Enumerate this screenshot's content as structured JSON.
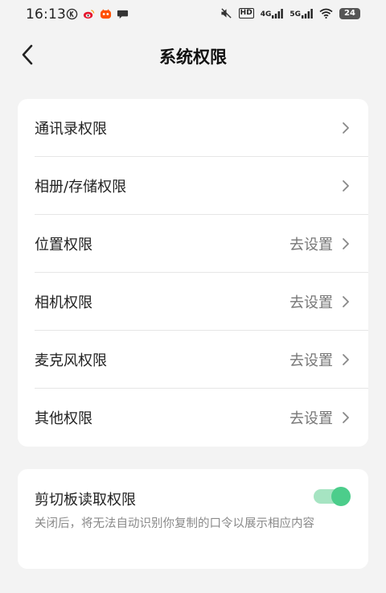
{
  "status_bar": {
    "time": "16:13",
    "hd_label": "HD",
    "net_4g": "4G",
    "net_5g": "5G",
    "battery": "24"
  },
  "header": {
    "title": "系统权限"
  },
  "permissions": [
    {
      "label": "通讯录权限",
      "value": ""
    },
    {
      "label": "相册/存储权限",
      "value": ""
    },
    {
      "label": "位置权限",
      "value": "去设置"
    },
    {
      "label": "相机权限",
      "value": "去设置"
    },
    {
      "label": "麦克风权限",
      "value": "去设置"
    },
    {
      "label": "其他权限",
      "value": "去设置"
    }
  ],
  "clipboard": {
    "title": "剪切板读取权限",
    "description": "关闭后，将无法自动识别你复制的口令以展示相应内容",
    "enabled": true,
    "accent_color": "#4ccd8b"
  }
}
